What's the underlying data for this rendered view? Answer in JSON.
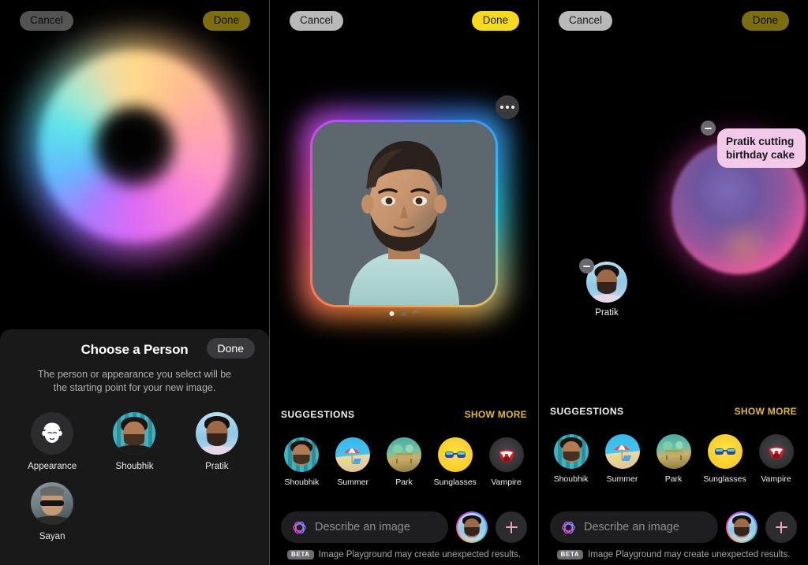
{
  "panels": {
    "one": {
      "name": "choose-person-sheet",
      "topbar": {
        "cancel": "Cancel",
        "done": "Done"
      },
      "sheet": {
        "title": "Choose a Person",
        "done": "Done",
        "subtitle": "The person or appearance you select will be the starting point for your new image.",
        "people": [
          {
            "label": "Appearance",
            "icon": "face-outline-icon"
          },
          {
            "label": "Shoubhik",
            "icon": "avatar"
          },
          {
            "label": "Pratik",
            "icon": "avatar"
          },
          {
            "label": "Sayan",
            "icon": "avatar"
          }
        ]
      }
    },
    "two": {
      "name": "generated-image-view",
      "topbar": {
        "cancel": "Cancel",
        "done": "Done"
      },
      "more_icon": "ellipsis-icon",
      "page_dots": [
        "active",
        "inactive",
        "loading"
      ],
      "suggestions": {
        "title": "SUGGESTIONS",
        "show_more": "SHOW MORE",
        "items": [
          {
            "label": "Shoubhik",
            "icon": "person-avatar-icon"
          },
          {
            "label": "Summer",
            "icon": "beach-umbrella-icon"
          },
          {
            "label": "Park",
            "icon": "park-bench-icon"
          },
          {
            "label": "Sunglasses",
            "icon": "sunglasses-icon"
          },
          {
            "label": "Vampire",
            "icon": "vampire-mouth-icon"
          }
        ]
      },
      "compose": {
        "ai_icon": "apple-intelligence-icon",
        "placeholder": "Describe an image",
        "avatar_icon": "person-avatar-icon",
        "add_icon": "plus-icon",
        "beta_tag": "BETA",
        "beta_text": "Image Playground may create unexpected results."
      }
    },
    "three": {
      "name": "prompt-editing-view",
      "topbar": {
        "cancel": "Cancel",
        "done": "Done"
      },
      "prompt_chip": {
        "text": "Pratik cutting birthday cake",
        "remove_icon": "minus-icon"
      },
      "person_chip": {
        "label": "Pratik",
        "remove_icon": "minus-icon"
      },
      "suggestions": {
        "title": "SUGGESTIONS",
        "show_more": "SHOW MORE",
        "items": [
          {
            "label": "Shoubhik",
            "icon": "person-avatar-icon"
          },
          {
            "label": "Summer",
            "icon": "beach-umbrella-icon"
          },
          {
            "label": "Park",
            "icon": "park-bench-icon"
          },
          {
            "label": "Sunglasses",
            "icon": "sunglasses-icon"
          },
          {
            "label": "Vampire",
            "icon": "vampire-mouth-icon"
          }
        ]
      },
      "compose": {
        "ai_icon": "apple-intelligence-icon",
        "placeholder": "Describe an image",
        "avatar_icon": "person-avatar-icon",
        "add_icon": "plus-icon",
        "beta_tag": "BETA",
        "beta_text": "Image Playground may create unexpected results."
      }
    }
  },
  "colors": {
    "accent_yellow": "#f8da1c",
    "show_more": "#e0b93a",
    "chip_pink": "#f2c9e8",
    "sheet_bg": "#191919"
  }
}
